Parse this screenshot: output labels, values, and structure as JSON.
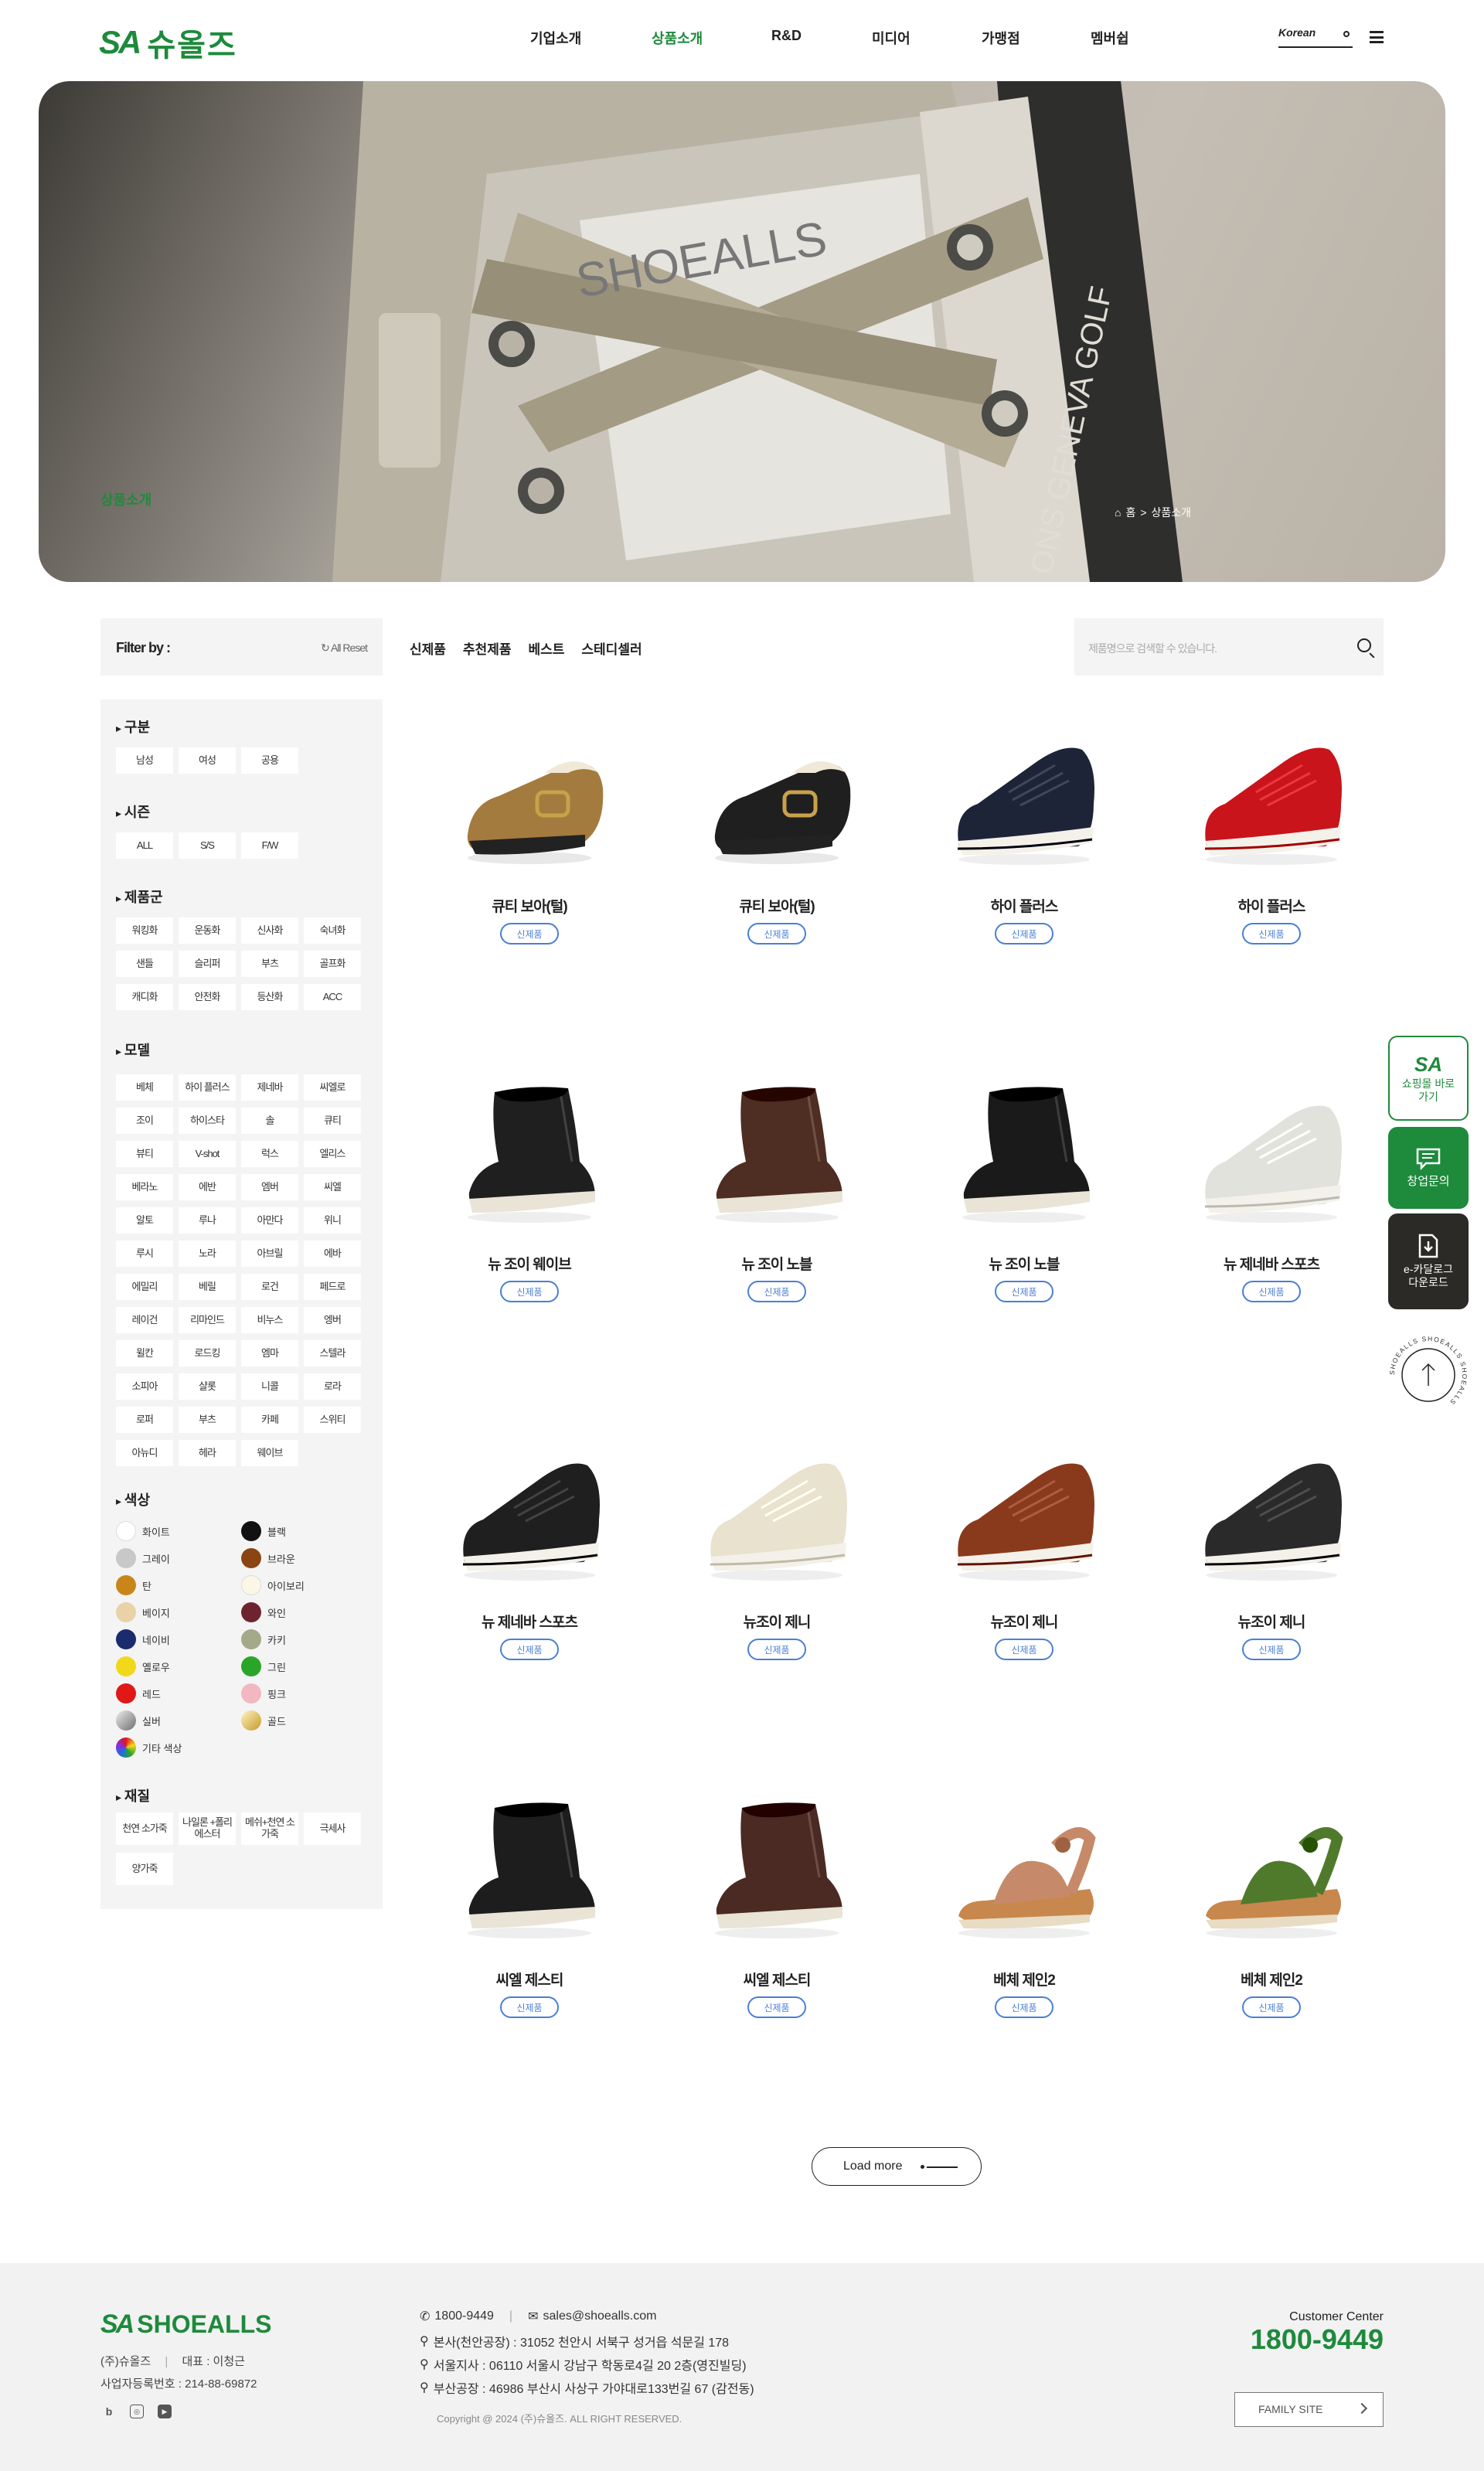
{
  "header": {
    "logo_mark": "SA",
    "logo_text": "슈올즈",
    "nav": [
      "기업소개",
      "상품소개",
      "R&D",
      "미디어",
      "가맹점",
      "멤버쉽"
    ],
    "active_nav": "상품소개",
    "language": "Korean"
  },
  "hero": {
    "title": "상품소개",
    "breadcrumb": [
      "홈",
      ">",
      "상품소개"
    ],
    "shoe_brand_text": "SHOEALLS",
    "shoe_side_text": "ONS GENEVA GOLF"
  },
  "filter": {
    "label": "Filter by :",
    "reset": "All Reset"
  },
  "tabs": [
    "신제품",
    "추천제품",
    "베스트",
    "스테디셀러"
  ],
  "search": {
    "placeholder": "제품명으로 검색할 수 있습니다."
  },
  "sidebar": {
    "category": {
      "title": "구분",
      "options": [
        "남성",
        "여성",
        "공용"
      ]
    },
    "season": {
      "title": "시즌",
      "options": [
        "ALL",
        "S/S",
        "F/W"
      ]
    },
    "product_group": {
      "title": "제품군",
      "options": [
        "워킹화",
        "운동화",
        "신사화",
        "숙녀화",
        "샌들",
        "슬리퍼",
        "부츠",
        "골프화",
        "캐디화",
        "안전화",
        "등산화",
        "ACC"
      ]
    },
    "model": {
      "title": "모델",
      "options": [
        "베체",
        "하이 플러스",
        "제네바",
        "씨엘로",
        "조이",
        "하이스타",
        "솔",
        "큐티",
        "뷰티",
        "V-shot",
        "럭스",
        "엘리스",
        "베라노",
        "에반",
        "엠버",
        "씨엘",
        "알토",
        "루나",
        "아만다",
        "위니",
        "루시",
        "노라",
        "아브릴",
        "에바",
        "에밀리",
        "베릴",
        "로건",
        "페드로",
        "레이건",
        "리마인드",
        "비누스",
        "엥버",
        "윌칸",
        "로드킹",
        "엠마",
        "스텔라",
        "소피아",
        "샬롯",
        "니콜",
        "로라",
        "로퍼",
        "부츠",
        "카페",
        "스위티",
        "아뉴디",
        "헤라",
        "웨이브"
      ]
    },
    "color": {
      "title": "색상",
      "options": [
        {
          "name": "화이트",
          "hex": "#ffffff"
        },
        {
          "name": "블랙",
          "hex": "#111111"
        },
        {
          "name": "그레이",
          "hex": "#c8c8c8"
        },
        {
          "name": "브라운",
          "hex": "#8b4513"
        },
        {
          "name": "탄",
          "hex": "#c8861a"
        },
        {
          "name": "아이보리",
          "hex": "#fbf6e6"
        },
        {
          "name": "베이지",
          "hex": "#e9d2a8"
        },
        {
          "name": "와인",
          "hex": "#6e2430"
        },
        {
          "name": "네이비",
          "hex": "#1c2a6e"
        },
        {
          "name": "카키",
          "hex": "#a4a98a"
        },
        {
          "name": "옐로우",
          "hex": "#f2d81a"
        },
        {
          "name": "그린",
          "hex": "#2aa52a"
        },
        {
          "name": "레드",
          "hex": "#e01818"
        },
        {
          "name": "핑크",
          "hex": "#f3b7c2"
        },
        {
          "name": "실버",
          "hex": "#9a9a9a"
        },
        {
          "name": "골드",
          "hex": "#d9b649"
        },
        {
          "name": "기타 색상",
          "hex": "#e14bd0"
        }
      ]
    },
    "material": {
      "title": "재질",
      "options": [
        "천연 소가죽",
        "나일론 +폴리에스터",
        "메쉬+천연 소가죽",
        "극세사",
        "양가죽"
      ]
    }
  },
  "products": [
    {
      "name": "큐티 보아(털)",
      "badge": "신제품",
      "color": "#a47b3e",
      "kind": "clog"
    },
    {
      "name": "큐티 보아(털)",
      "badge": "신제품",
      "color": "#1f1f1f",
      "kind": "clog"
    },
    {
      "name": "하이 플러스",
      "badge": "신제품",
      "color": "#1d2438",
      "kind": "sneaker"
    },
    {
      "name": "하이 플러스",
      "badge": "신제품",
      "color": "#c8141a",
      "kind": "sneaker"
    },
    {
      "name": "뉴 조이 웨이브",
      "badge": "신제품",
      "color": "#1f1f1f",
      "kind": "boot"
    },
    {
      "name": "뉴 조이 노블",
      "badge": "신제품",
      "color": "#4e2d22",
      "kind": "boot"
    },
    {
      "name": "뉴 조이 노블",
      "badge": "신제품",
      "color": "#1a1a1a",
      "kind": "boot"
    },
    {
      "name": "뉴 제네바 스포츠",
      "badge": "신제품",
      "color": "#e2e2dc",
      "kind": "sneaker"
    },
    {
      "name": "뉴 제네바 스포츠",
      "badge": "신제품",
      "color": "#1f1f1f",
      "kind": "sneaker"
    },
    {
      "name": "뉴조이 제니",
      "badge": "신제품",
      "color": "#e8e2ce",
      "kind": "sneaker"
    },
    {
      "name": "뉴조이 제니",
      "badge": "신제품",
      "color": "#8a3a1c",
      "kind": "sneaker"
    },
    {
      "name": "뉴조이 제니",
      "badge": "신제품",
      "color": "#2a2a2a",
      "kind": "sneaker"
    },
    {
      "name": "씨엘 제스티",
      "badge": "신제품",
      "color": "#1d1d1d",
      "kind": "boot"
    },
    {
      "name": "씨엘 제스티",
      "badge": "신제품",
      "color": "#4a2a22",
      "kind": "boot"
    },
    {
      "name": "베체 제인2",
      "badge": "신제품",
      "color": "#c68a6a",
      "kind": "sandal"
    },
    {
      "name": "베체 제인2",
      "badge": "신제품",
      "color": "#4f7a2c",
      "kind": "sandal"
    }
  ],
  "load_more": "Load more",
  "quick_menu": [
    {
      "icon": "SA",
      "label": "쇼핑몰 바로가기"
    },
    {
      "icon": "chat",
      "label": "창업문의"
    },
    {
      "icon": "download",
      "label": "e-카달로그 다운로드"
    }
  ],
  "top_ring_text": "SHOEALLS SHOEALLS SHOEALLS",
  "footer": {
    "logo_mark": "SA",
    "logo_text": "SHOEALLS",
    "company": "(주)슈올즈",
    "ceo": "대표 : 이청근",
    "biz_no": "사업자등록번호 : 214-88-69872",
    "phone": "1800-9449",
    "email": "sales@shoealls.com",
    "addresses": [
      "본사(천안공장) : 31052 천안시 서북구 성거읍 석문길 178",
      "서울지사 : 06110 서울시 강남구 학동로4길 20 2층(영진빌딩)",
      "부산공장 : 46986 부산시 사상구 가야대로133번길 67 (감전동)"
    ],
    "copyright": "Copyright @ 2024 (주)슈올즈. ALL RIGHT RESERVED.",
    "cc_label": "Customer Center",
    "cc_number": "1800-9449",
    "family_site": "FAMILY SITE",
    "social": [
      "b",
      "ig",
      "yt"
    ]
  }
}
